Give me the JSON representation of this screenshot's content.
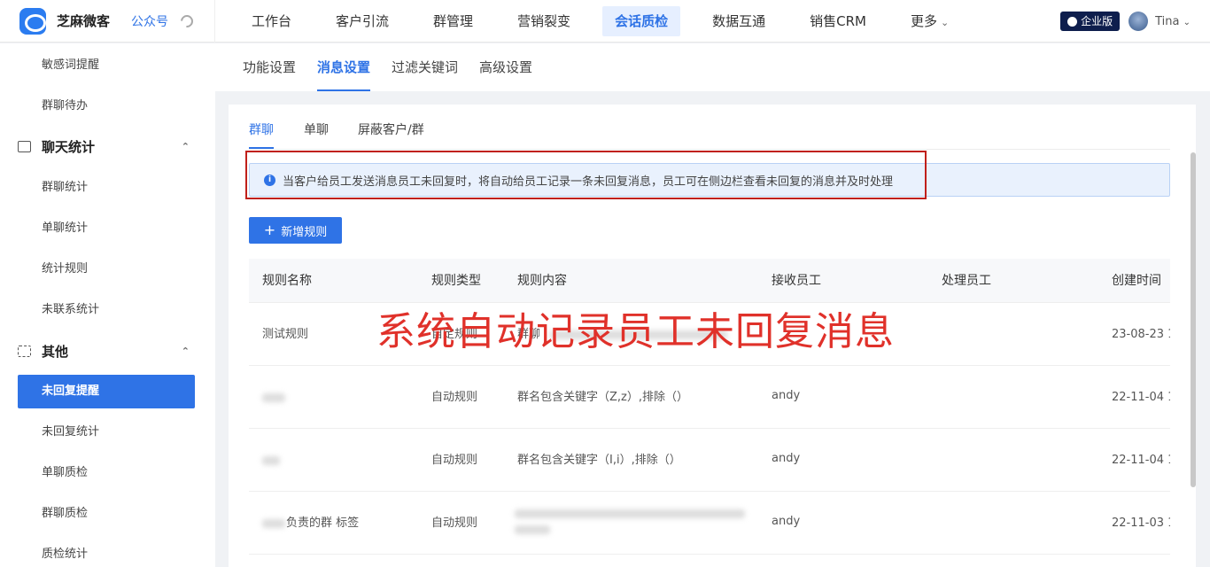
{
  "brand": {
    "name": "芝麻微客",
    "account_link": "公众号"
  },
  "nav": {
    "items": [
      "工作台",
      "客户引流",
      "群管理",
      "营销裂变",
      "会话质检",
      "数据互通",
      "销售CRM",
      "更多"
    ],
    "active": "会话质检"
  },
  "header_right": {
    "edition_badge": "企业版",
    "user_name": "Tina"
  },
  "sidebar": {
    "items": [
      {
        "label": "敏感词提醒",
        "kind": "item"
      },
      {
        "label": "群聊待办",
        "kind": "item"
      },
      {
        "label": "聊天统计",
        "kind": "group"
      },
      {
        "label": "群聊统计",
        "kind": "item"
      },
      {
        "label": "单聊统计",
        "kind": "item"
      },
      {
        "label": "统计规则",
        "kind": "item"
      },
      {
        "label": "未联系统计",
        "kind": "item"
      },
      {
        "label": "其他",
        "kind": "group"
      },
      {
        "label": "未回复提醒",
        "kind": "item",
        "active": true
      },
      {
        "label": "未回复统计",
        "kind": "item"
      },
      {
        "label": "单聊质检",
        "kind": "item"
      },
      {
        "label": "群聊质检",
        "kind": "item"
      },
      {
        "label": "质检统计",
        "kind": "item"
      }
    ]
  },
  "subtabs": {
    "items": [
      "功能设置",
      "消息设置",
      "过滤关键词",
      "高级设置"
    ],
    "active": "消息设置"
  },
  "innertabs": {
    "items": [
      "群聊",
      "单聊",
      "屏蔽客户/群"
    ],
    "active": "群聊"
  },
  "notice": "当客户给员工发送消息员工未回复时，将自动给员工记录一条未回复消息，员工可在侧边栏查看未回复的消息并及时处理",
  "add_button": "新增规则",
  "table": {
    "columns": [
      "规则名称",
      "规则类型",
      "规则内容",
      "接收员工",
      "处理员工",
      "创建时间"
    ],
    "rows": [
      {
        "name": "测试规则",
        "type": "自定规则",
        "content": "群聊",
        "receiver": "",
        "handler": "",
        "created": "23-08-23 1("
      },
      {
        "name": "",
        "type": "自动规则",
        "content": "群名包含关键字（Z,z）,排除（）",
        "receiver": "andy",
        "handler": "",
        "created": "22-11-04 1."
      },
      {
        "name": "",
        "type": "自动规则",
        "content": "群名包含关键字（I,i）,排除（）",
        "receiver": "andy",
        "handler": "",
        "created": "22-11-04 1."
      },
      {
        "name": "负责的群 标签",
        "type": "自动规则",
        "content": "",
        "receiver": "andy",
        "handler": "",
        "created": "22-11-03 1"
      }
    ]
  },
  "overlay_caption": "系统自动记录员工未回复消息",
  "colors": {
    "accent": "#2f73e6",
    "highlight_border": "#c0201a",
    "caption": "#e0312a"
  }
}
